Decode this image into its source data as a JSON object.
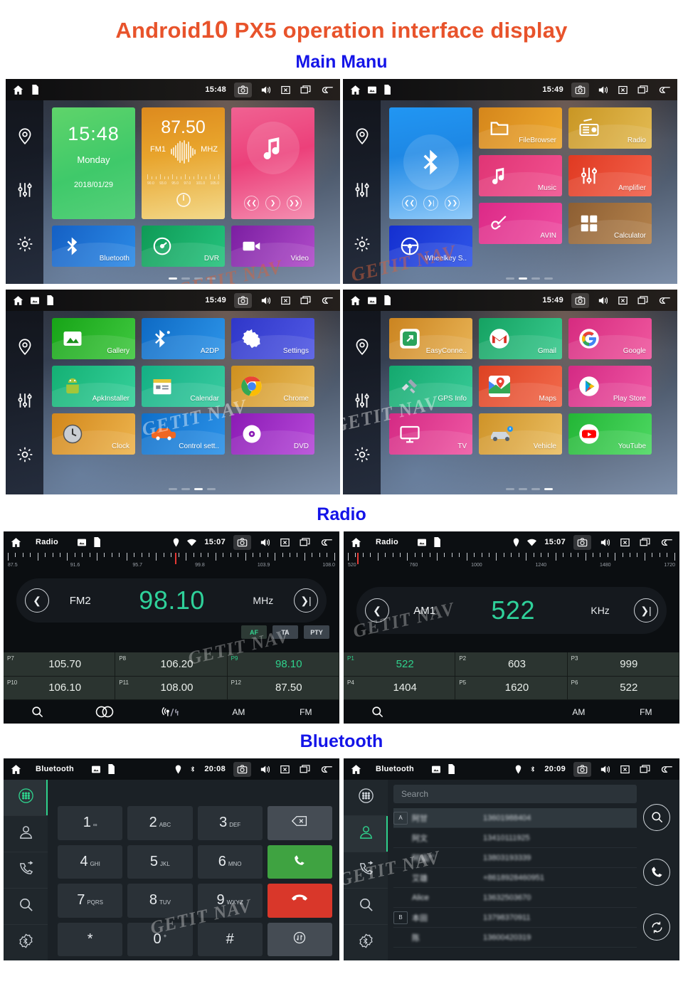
{
  "header": {
    "title_prefix": "Android",
    "title_number": "10",
    "title_suffix": " PX5 operation interface display",
    "accent_color": "#e8532b",
    "section_color": "#1414e8"
  },
  "sections": [
    {
      "id": "main-manu",
      "label": "Main Manu"
    },
    {
      "id": "radio",
      "label": "Radio"
    },
    {
      "id": "bluetooth",
      "label": "Bluetooth"
    }
  ],
  "watermark": {
    "text": "GETIT NAV"
  },
  "statusbar_icons": {
    "home": "home-icon",
    "image": "image-icon",
    "sdcard": "sdcard-icon",
    "location": "location-icon",
    "wifi": "wifi-icon",
    "bluetooth": "bluetooth-icon",
    "camera": "camera-icon",
    "volume": "volume-icon",
    "close": "close-box-icon",
    "recents": "recent-apps-icon",
    "back": "back-arrow-icon"
  },
  "sidebar": {
    "items": [
      {
        "name": "navigation",
        "icon": "location-pin-icon"
      },
      {
        "name": "equalizer",
        "icon": "sliders-icon"
      },
      {
        "name": "settings",
        "icon": "gear-icon"
      }
    ]
  },
  "screen1": {
    "time": "15:48",
    "clock_widget": {
      "time": "15:48",
      "day": "Monday",
      "date": "2018/01/29"
    },
    "radio_widget": {
      "frequency": "87.50",
      "band": "FM1",
      "unit": "MHZ",
      "scale_labels": [
        "90.0",
        "93.0",
        "95.0",
        "97.0",
        "101.0",
        "105.0"
      ]
    },
    "tiles": [
      {
        "label": "Bluetooth",
        "icon": "bluetooth-icon",
        "color": "#1a6fd4"
      },
      {
        "label": "DVR",
        "icon": "gauge-icon",
        "color": "#18a463"
      },
      {
        "label": "Video",
        "icon": "video-camera-icon",
        "color": "#8e24aa"
      }
    ],
    "page_dots": {
      "count": 4,
      "active": 0
    }
  },
  "screen2": {
    "time": "15:49",
    "bluetooth_widget": {
      "icon": "bluetooth-icon"
    },
    "tiles": [
      {
        "label": "FileBrowser",
        "icon": "folder-icon",
        "color": "#e2921f"
      },
      {
        "label": "Radio",
        "icon": "radio-icon",
        "color": "#d6a32c"
      },
      {
        "label": "Music",
        "icon": "music-note-icon",
        "color": "#e8467f"
      },
      {
        "label": "Amplifier",
        "icon": "sliders-icon",
        "color": "#e8442d"
      },
      {
        "label": "Wheelkey S..",
        "icon": "steering-wheel-icon",
        "color": "#1b35d6"
      },
      {
        "label": "AVIN",
        "icon": "plug-cable-icon",
        "color": "#e0338f"
      },
      {
        "label": "Calculator",
        "icon": "calculator-icon",
        "color": "#9a6a3a"
      }
    ],
    "page_dots": {
      "count": 4,
      "active": 1
    }
  },
  "screen3": {
    "time": "15:49",
    "tiles": [
      {
        "label": "Gallery",
        "icon": "photo-icon",
        "color": "#24b324"
      },
      {
        "label": "A2DP",
        "icon": "bluetooth-audio-icon",
        "color": "#1277d6"
      },
      {
        "label": "Settings",
        "icon": "gear-icon",
        "color": "#3b44d4"
      },
      {
        "label": "ApkInstaller",
        "icon": "android-wrench-icon",
        "color": "#1fbf7a"
      },
      {
        "label": "Calendar",
        "icon": "calendar-icon",
        "color": "#1fbf8f"
      },
      {
        "label": "Chrome",
        "icon": "chrome-icon",
        "color": "#dfa02a"
      },
      {
        "label": "Clock",
        "icon": "clock-icon",
        "color": "#e09320"
      },
      {
        "label": "Control sett..",
        "icon": "car-icon",
        "color": "#1479d6"
      },
      {
        "label": "DVD",
        "icon": "disc-icon",
        "color": "#9b20c4"
      }
    ],
    "page_dots": {
      "count": 4,
      "active": 2
    }
  },
  "screen4": {
    "time": "15:49",
    "tiles": [
      {
        "label": "EasyConne..",
        "icon": "easyconnect-icon",
        "color": "#dc9225"
      },
      {
        "label": "Gmail",
        "icon": "gmail-icon",
        "color": "#1bb36f"
      },
      {
        "label": "Google",
        "icon": "google-icon",
        "color": "#e23a8c"
      },
      {
        "label": "GPS Info",
        "icon": "satellite-icon",
        "color": "#1cb878"
      },
      {
        "label": "Maps",
        "icon": "maps-icon",
        "color": "#e8512c"
      },
      {
        "label": "Play Store",
        "icon": "play-store-icon",
        "color": "#e2338d"
      },
      {
        "label": "TV",
        "icon": "tv-icon",
        "color": "#e0348f"
      },
      {
        "label": "Vehicle",
        "icon": "car-icon",
        "color": "#dda030"
      },
      {
        "label": "YouTube",
        "icon": "youtube-icon",
        "color": "#2cc442"
      }
    ],
    "page_dots": {
      "count": 4,
      "active": 3
    }
  },
  "radio_fm": {
    "title": "Radio",
    "time": "15:07",
    "band": "FM2",
    "frequency": "98.10",
    "unit": "MHz",
    "scale_labels": [
      "87.5",
      "91.6",
      "95.7",
      "99.8",
      "103.9",
      "108.0"
    ],
    "needle_percent": 52,
    "rds": [
      {
        "label": "AF",
        "active": true
      },
      {
        "label": "TA",
        "active": false
      },
      {
        "label": "PTY",
        "active": false
      }
    ],
    "presets": [
      {
        "slot": "P7",
        "value": "105.70",
        "active": false
      },
      {
        "slot": "P8",
        "value": "106.20",
        "active": false
      },
      {
        "slot": "P9",
        "value": "98.10",
        "active": true
      },
      {
        "slot": "P10",
        "value": "106.10",
        "active": false
      },
      {
        "slot": "P11",
        "value": "108.00",
        "active": false
      },
      {
        "slot": "P12",
        "value": "87.50",
        "active": false
      }
    ],
    "bottom_bar": [
      {
        "label": "",
        "icon": "search-icon"
      },
      {
        "label": "",
        "icon": "stereo-icon"
      },
      {
        "label": "",
        "icon": "antenna-loc-dx-icon"
      },
      {
        "label": "AM",
        "icon": ""
      },
      {
        "label": "FM",
        "icon": ""
      }
    ]
  },
  "radio_am": {
    "title": "Radio",
    "time": "15:07",
    "band": "AM1",
    "frequency": "522",
    "unit": "KHz",
    "scale_labels": [
      "520",
      "760",
      "1000",
      "1240",
      "1480",
      "1720"
    ],
    "needle_percent": 4,
    "presets": [
      {
        "slot": "P1",
        "value": "522",
        "active": true
      },
      {
        "slot": "P2",
        "value": "603",
        "active": false
      },
      {
        "slot": "P3",
        "value": "999",
        "active": false
      },
      {
        "slot": "P4",
        "value": "1404",
        "active": false
      },
      {
        "slot": "P5",
        "value": "1620",
        "active": false
      },
      {
        "slot": "P6",
        "value": "522",
        "active": false
      }
    ],
    "bottom_bar": [
      {
        "label": "",
        "icon": "search-icon"
      },
      {
        "label": "",
        "icon": ""
      },
      {
        "label": "",
        "icon": ""
      },
      {
        "label": "AM",
        "icon": ""
      },
      {
        "label": "FM",
        "icon": ""
      }
    ]
  },
  "bt_dialer": {
    "title": "Bluetooth",
    "time": "20:08",
    "side_items": [
      {
        "name": "dialpad",
        "icon": "dialpad-icon",
        "active": true
      },
      {
        "name": "contacts",
        "icon": "contact-person-icon",
        "active": false
      },
      {
        "name": "call-history",
        "icon": "call-history-icon",
        "active": false
      },
      {
        "name": "search",
        "icon": "search-icon",
        "active": false
      },
      {
        "name": "bt-settings",
        "icon": "bluetooth-gear-icon",
        "active": false
      }
    ],
    "keys": [
      {
        "digit": "1",
        "sub": "∞"
      },
      {
        "digit": "2",
        "sub": "ABC"
      },
      {
        "digit": "3",
        "sub": "DEF"
      },
      {
        "digit": "",
        "sub": "",
        "icon": "backspace-icon",
        "style": "fn"
      },
      {
        "digit": "4",
        "sub": "GHI"
      },
      {
        "digit": "5",
        "sub": "JKL"
      },
      {
        "digit": "6",
        "sub": "MNO"
      },
      {
        "digit": "",
        "sub": "",
        "icon": "call-icon",
        "style": "green"
      },
      {
        "digit": "7",
        "sub": "PQRS"
      },
      {
        "digit": "8",
        "sub": "TUV"
      },
      {
        "digit": "9",
        "sub": "WXYZ"
      },
      {
        "digit": "",
        "sub": "",
        "icon": "hangup-icon",
        "style": "red"
      },
      {
        "digit": "*",
        "sub": ""
      },
      {
        "digit": "0",
        "sub": "+"
      },
      {
        "digit": "#",
        "sub": ""
      },
      {
        "digit": "",
        "sub": "",
        "icon": "transfer-icon",
        "style": "fn"
      }
    ]
  },
  "bt_contacts": {
    "title": "Bluetooth",
    "time": "20:09",
    "search_placeholder": "Search",
    "rows": [
      {
        "index": "A",
        "name": "阿甘",
        "number": "13601988404",
        "selected": true
      },
      {
        "index": "",
        "name": "阿文",
        "number": "13410111925",
        "selected": false
      },
      {
        "index": "",
        "name": "阿福广",
        "number": "13803193339",
        "selected": false
      },
      {
        "index": "",
        "name": "艾雄",
        "number": "+8618928460951",
        "selected": false
      },
      {
        "index": "",
        "name": "Alice",
        "number": "13632503670",
        "selected": false
      },
      {
        "index": "B",
        "name": "本田",
        "number": "13798370911",
        "selected": false
      },
      {
        "index": "",
        "name": "陈",
        "number": "13600420319",
        "selected": false
      }
    ],
    "actions": [
      {
        "name": "search",
        "icon": "search-icon"
      },
      {
        "name": "call",
        "icon": "call-icon"
      },
      {
        "name": "sync",
        "icon": "sync-icon"
      }
    ]
  }
}
